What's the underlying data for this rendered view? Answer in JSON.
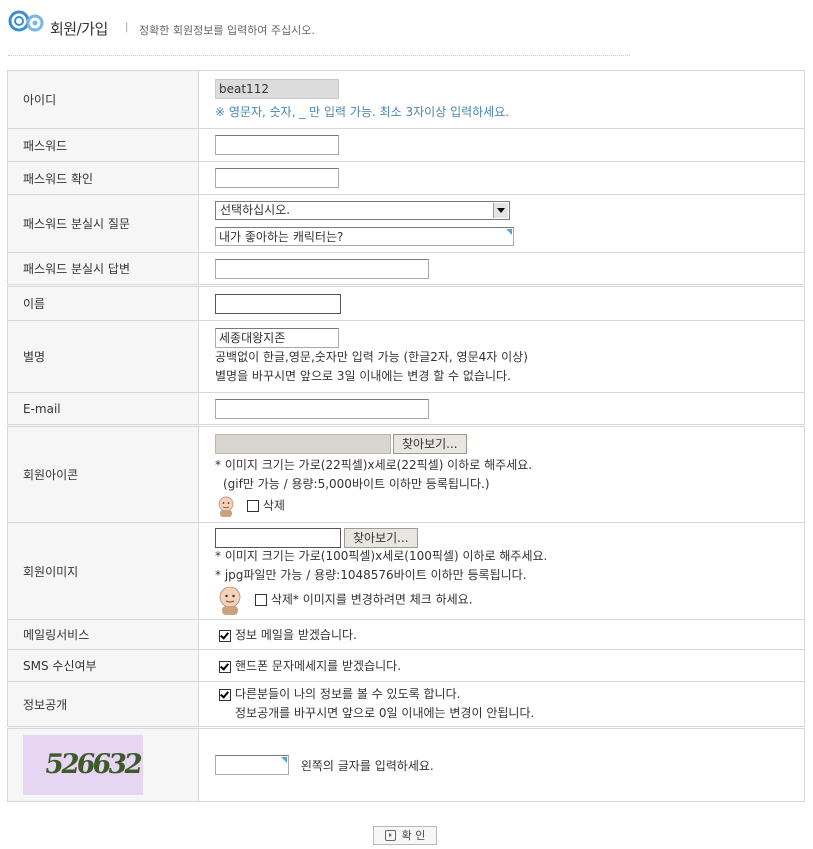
{
  "header": {
    "title": "회원/가입",
    "separator": "|",
    "subtitle": "정확한 회원정보를 입력하여 주십시오."
  },
  "form": {
    "userid": {
      "label": "아이디",
      "value": "beat112",
      "hint": "※ 영문자, 숫자, _ 만 입력 가능. 최소 3자이상 입력하세요."
    },
    "password": {
      "label": "패스워드",
      "value": ""
    },
    "password_confirm": {
      "label": "패스워드 확인",
      "value": ""
    },
    "pw_question": {
      "label": "패스워드 분실시 질문",
      "selected": "선택하십시오.",
      "custom_value": "내가 좋아하는 캐릭터는?"
    },
    "pw_answer": {
      "label": "패스워드 분실시 답변",
      "value": ""
    },
    "name": {
      "label": "이름",
      "value": ""
    },
    "nickname": {
      "label": "별명",
      "value": "세종대왕지존",
      "hint1": "공백없이 한글,영문,숫자만 입력 가능 (한글2자, 영문4자 이상)",
      "hint2": "별명을 바꾸시면 앞으로 3일 이내에는 변경 할 수 없습니다."
    },
    "email": {
      "label": "E-mail",
      "value": ""
    },
    "member_icon": {
      "label": "회원아이콘",
      "browse_label": "찾아보기...",
      "hint1": "* 이미지 크기는 가로(22픽셀)x세로(22픽셀) 이하로 해주세요.",
      "hint2": "(gif만 가능 / 용량:5,000바이트 이하만 등록됩니다.)",
      "delete_label": "삭제"
    },
    "member_image": {
      "label": "회원이미지",
      "browse_label": "찾아보기...",
      "hint1": "* 이미지 크기는 가로(100픽셀)x세로(100픽셀) 이하로 해주세요.",
      "hint2": "* jpg파일만 가능 / 용량:1048576바이트 이하만 등록됩니다.",
      "delete_label": "삭제* 이미지를 변경하려면 체크 하세요."
    },
    "mailing": {
      "label": "메일링서비스",
      "checkbox_label": "정보 메일을 받겠습니다.",
      "checked": true
    },
    "sms": {
      "label": "SMS 수신여부",
      "checkbox_label": "핸드폰 문자메세지를 받겠습니다.",
      "checked": true
    },
    "open_info": {
      "label": "정보공개",
      "checkbox_label": "다른분들이 나의 정보를 볼 수 있도록 합니다.",
      "note": "정보공개를 바꾸시면 앞으로 0일 이내에는 변경이 안됩니다.",
      "checked": true
    },
    "captcha": {
      "code": "526632",
      "value": "",
      "hint": "왼쪽의 글자를 입력하세요."
    }
  },
  "submit": {
    "label": "확 인"
  },
  "colors": {
    "hint": "#4a86b0",
    "label_bg": "#f6f6f6",
    "border": "#d7d7d7",
    "captcha_bg": "#e7d6f3",
    "logo": "#3b8fd0"
  },
  "icons": [
    "logo-circles-icon",
    "select-arrow-icon",
    "checkbox-icon",
    "avatar-face-icon",
    "play-icon"
  ]
}
